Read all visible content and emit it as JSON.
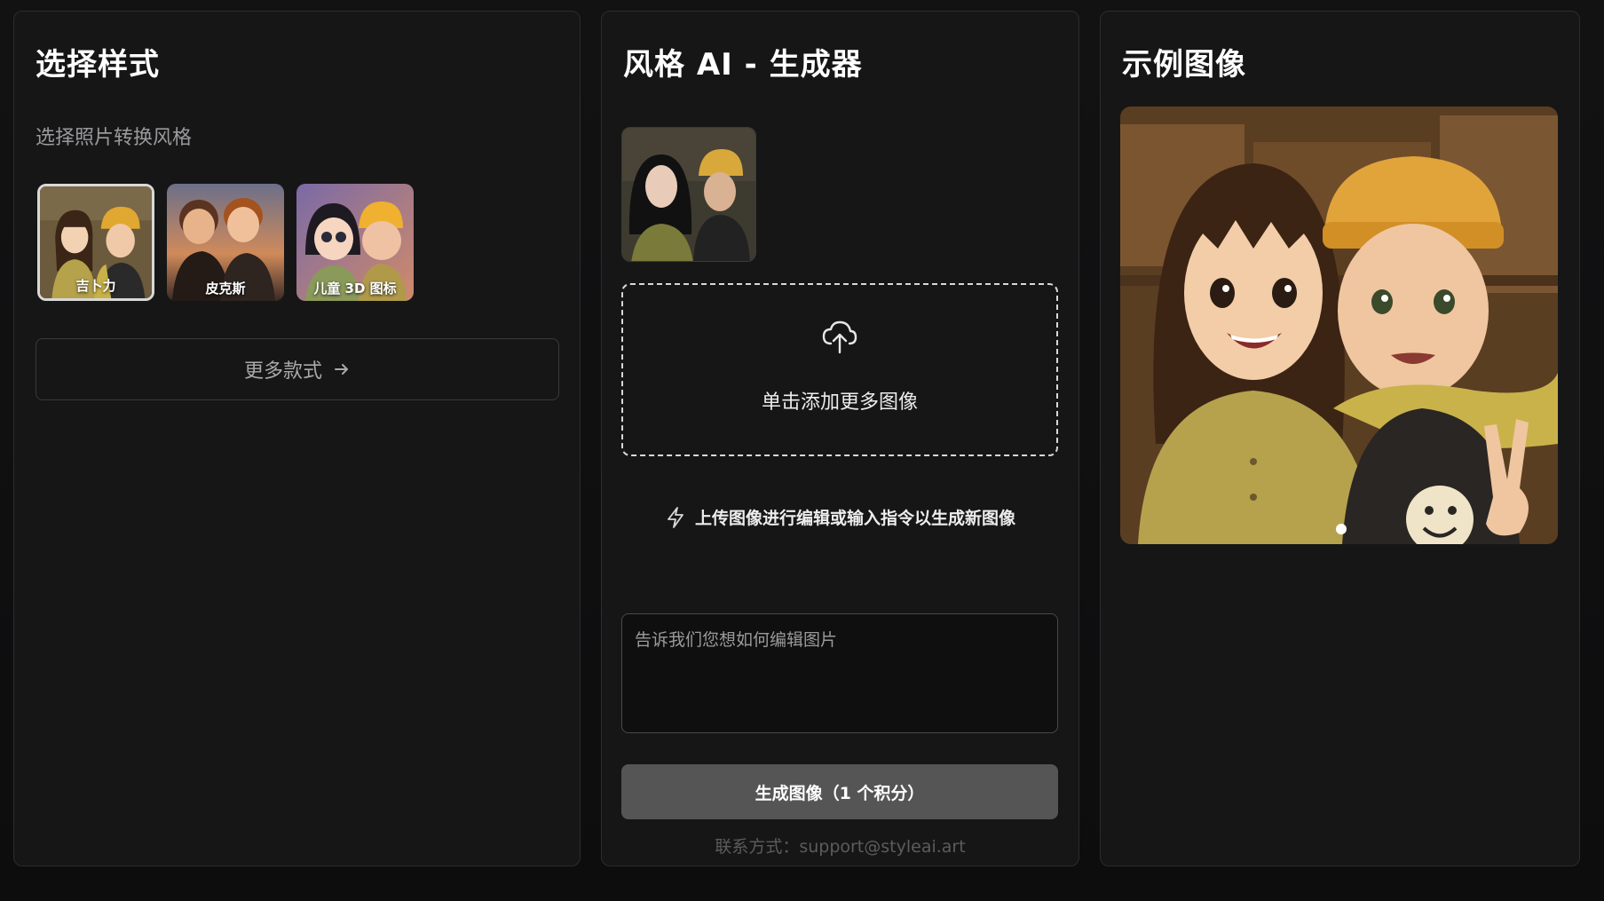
{
  "left_panel": {
    "title": "选择样式",
    "subtitle": "选择照片转换风格",
    "styles": [
      {
        "label": "吉卜力",
        "selected": true,
        "icon": "ghibli-style-thumbnail"
      },
      {
        "label": "皮克斯",
        "selected": false,
        "icon": "pixar-style-thumbnail"
      },
      {
        "label": "儿童 3D 图标",
        "selected": false,
        "icon": "kids-3d-style-thumbnail"
      }
    ],
    "more_button": {
      "label": "更多款式",
      "icon": "arrow-right-icon"
    }
  },
  "middle_panel": {
    "title": "风格 AI - 生成器",
    "uploaded_image": {
      "icon": "uploaded-photo"
    },
    "dropzone": {
      "text": "单击添加更多图像",
      "icon": "cloud-upload-icon"
    },
    "hint": {
      "text": "上传图像进行编辑或输入指令以生成新图像",
      "icon": "lightning-icon"
    },
    "prompt": {
      "placeholder": "告诉我们您想如何编辑图片",
      "value": ""
    },
    "generate_button": {
      "label": "生成图像（1 个积分）"
    },
    "contact": "联系方式：support@styleai.art"
  },
  "right_panel": {
    "title": "示例图像",
    "example_image": {
      "icon": "ghibli-example-image"
    },
    "carousel": {
      "active_index": 0,
      "count": 1
    }
  },
  "colors": {
    "background": "#0f0f10",
    "panel": "#161617",
    "border": "#2c2c2e",
    "button": "#555556",
    "muted_text": "#9a9a9c"
  }
}
